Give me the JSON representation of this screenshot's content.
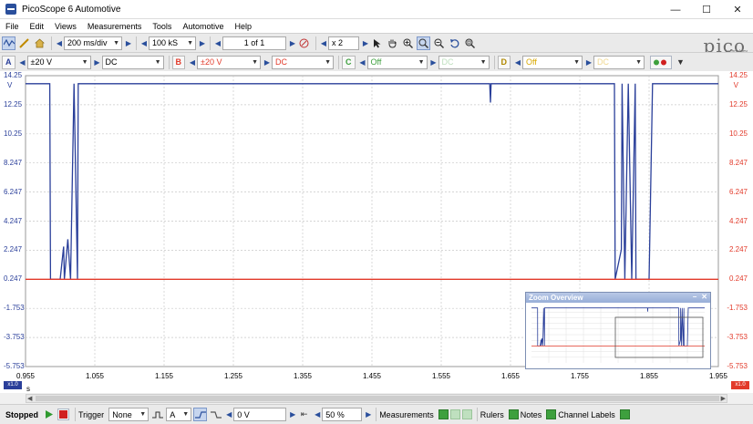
{
  "window": {
    "title": "PicoScope 6 Automotive",
    "minimize_glyph": "—",
    "maximize_glyph": "☐",
    "close_glyph": "✕"
  },
  "menu": [
    "File",
    "Edit",
    "Views",
    "Measurements",
    "Tools",
    "Automotive",
    "Help"
  ],
  "toolbar1": {
    "timebase": "200 ms/div",
    "samples": "100 kS",
    "page": "1 of 1",
    "zoom": "x 2"
  },
  "brand": {
    "logo": "pico",
    "sub": "technology"
  },
  "channels": [
    {
      "id": "A",
      "range": "±20 V",
      "coupling": "DC",
      "color": "#2a3f9a"
    },
    {
      "id": "B",
      "range": "±20 V",
      "coupling": "DC",
      "color": "#e23a2a"
    },
    {
      "id": "C",
      "range": "Off",
      "coupling": "DC",
      "color": "#3ea03e"
    },
    {
      "id": "D",
      "range": "Off",
      "coupling": "DC",
      "color": "#d8a800"
    }
  ],
  "plot": {
    "y_unit": "V",
    "x_unit": "s",
    "y_ticks": [
      "14.25",
      "12.25",
      "10.25",
      "8.247",
      "6.247",
      "4.247",
      "2.247",
      "0.247",
      "-1.753",
      "-3.753",
      "-5.753"
    ],
    "y_ticks_right": [
      "14.25",
      "12.25",
      "10.25",
      "8.247",
      "6.247",
      "4.247",
      "2.247",
      "0.247",
      "-1.753",
      "-3.753",
      "-5.753"
    ],
    "x_ticks": [
      "0.955",
      "1.055",
      "1.155",
      "1.255",
      "1.355",
      "1.455",
      "1.555",
      "1.655",
      "1.755",
      "1.855",
      "1.955"
    ],
    "scale_left": "x1.0",
    "scale_right": "x1.0"
  },
  "chart_data": {
    "type": "line",
    "xlabel": "s",
    "ylabel": "V",
    "xlim": [
      0.955,
      1.955
    ],
    "ylim": [
      -5.753,
      14.25
    ],
    "grid": true,
    "series": [
      {
        "color": "#2a3f9a",
        "x": [
          0.955,
          0.99,
          0.991,
          1.005,
          1.01,
          1.011,
          1.016,
          1.02,
          1.025,
          1.03,
          1.031,
          1.05,
          1.625,
          1.626,
          1.627,
          1.805,
          1.806,
          1.815,
          1.816,
          1.82,
          1.825,
          1.83,
          1.835,
          1.836,
          1.855,
          1.86,
          1.955
        ],
        "y": [
          13.7,
          13.7,
          0.25,
          0.25,
          2.5,
          0.25,
          3.0,
          0.25,
          13.7,
          0.25,
          13.7,
          13.7,
          13.7,
          12.4,
          13.7,
          13.7,
          0.25,
          2.3,
          13.7,
          0.25,
          13.7,
          0.25,
          13.7,
          0.25,
          0.25,
          13.7,
          13.7
        ]
      },
      {
        "color": "#e23a2a",
        "x": [
          0.955,
          1.955
        ],
        "y": [
          0.247,
          0.247
        ]
      }
    ]
  },
  "zoom_overview": {
    "title": "Zoom Overview",
    "minimize": "–",
    "close": "✕"
  },
  "statusbar": {
    "state": "Stopped",
    "trigger_label": "Trigger",
    "trigger_mode": "None",
    "trigger_channel": "A",
    "trigger_level": "0 V",
    "pretrigger": "50 %",
    "measurements_label": "Measurements",
    "rulers_label": "Rulers",
    "notes_label": "Notes",
    "channel_labels_label": "Channel Labels"
  }
}
